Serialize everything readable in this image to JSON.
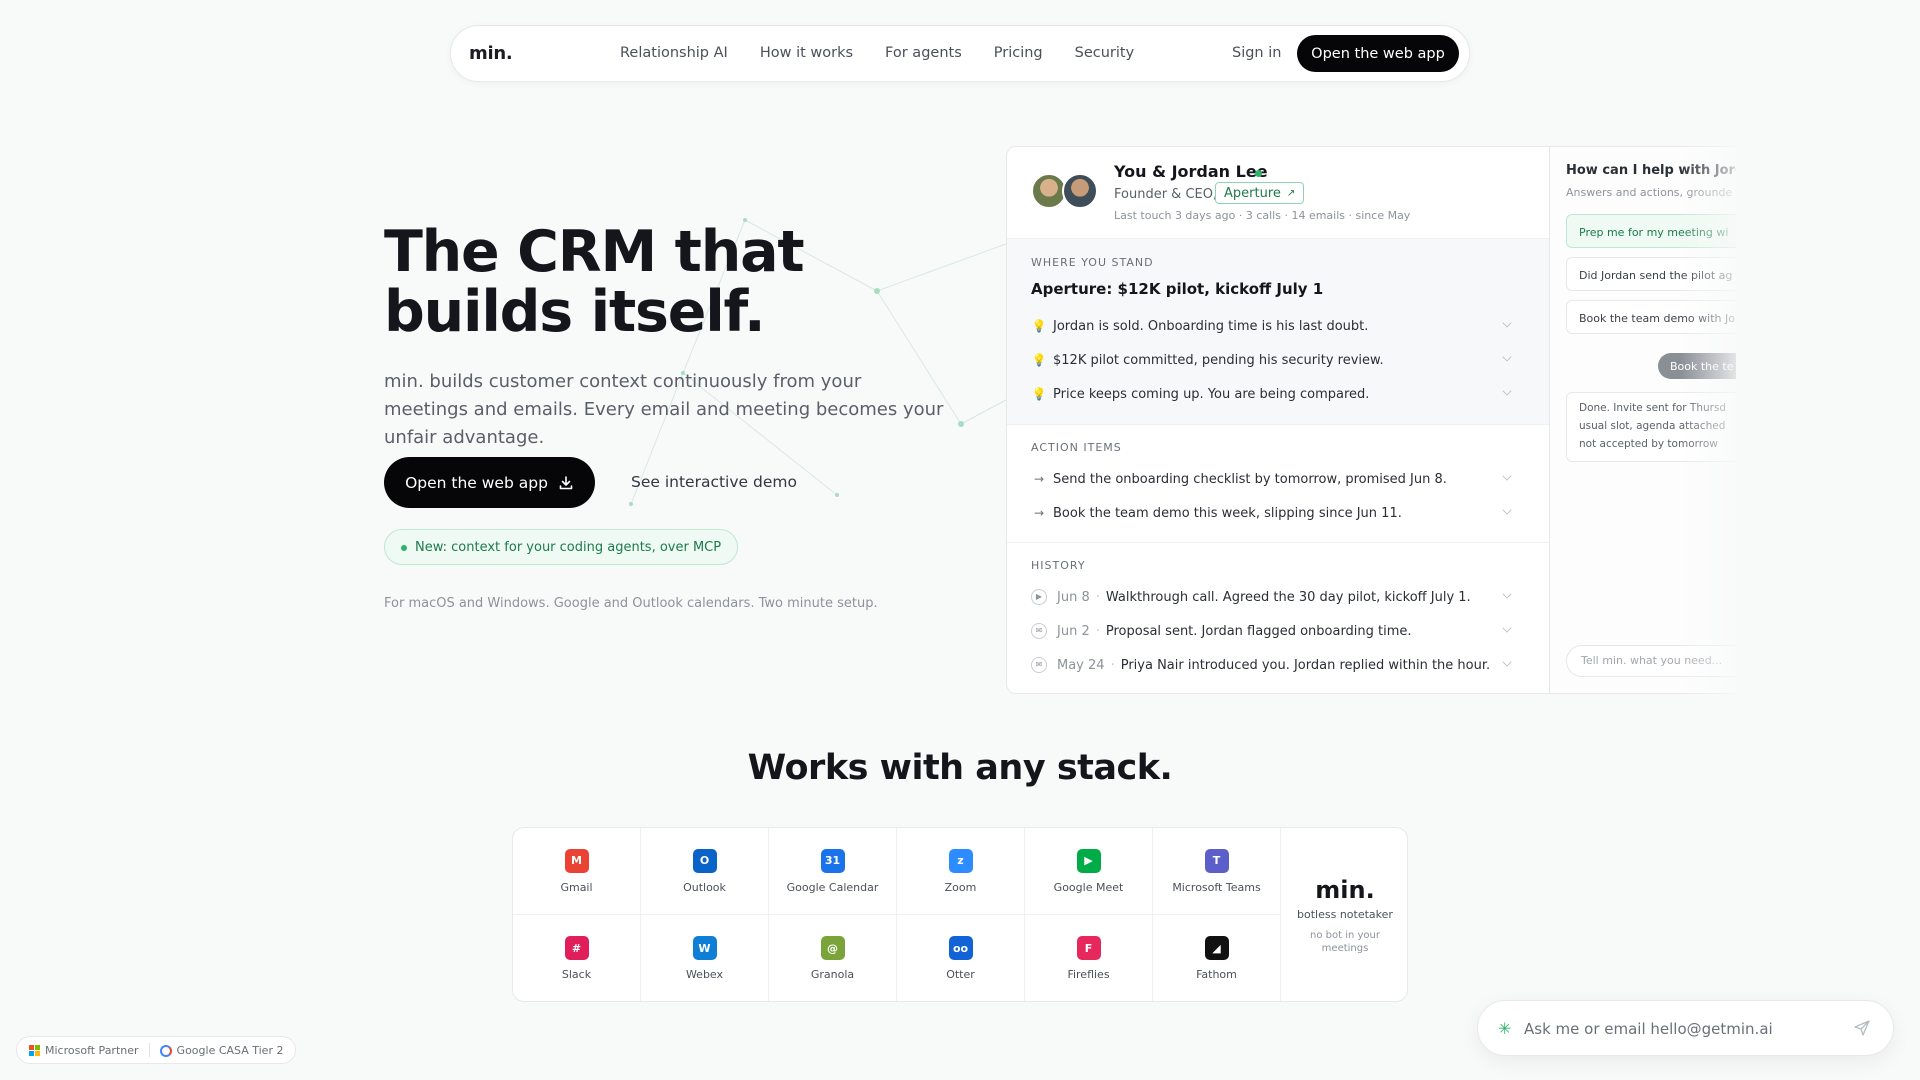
{
  "nav": {
    "logo": "min.",
    "links": [
      "Relationship AI",
      "How it works",
      "For agents",
      "Pricing",
      "Security"
    ],
    "signin": "Sign in",
    "cta": "Open the web app"
  },
  "hero": {
    "title": "The CRM that builds itself.",
    "subtitle": "min. builds customer context continuously from your meetings and emails. Every email and meeting becomes your unfair advantage.",
    "primary_button": "Open the web app",
    "demo_link": "See interactive demo",
    "mcp_pill": "New: context for your coding agents, over MCP",
    "platform_note": "For macOS and Windows. Google and Outlook calendars. Two minute setup."
  },
  "card": {
    "name": "You & Jordan Lee",
    "role": "Founder & CEO,",
    "company": "Aperture",
    "meta": "Last touch 3 days ago · 3 calls · 14 emails · since May",
    "where_label": "WHERE YOU STAND",
    "where_headline": "Aperture: $12K pilot, kickoff July 1",
    "where_items": [
      "Jordan is sold. Onboarding time is his last doubt.",
      "$12K pilot committed, pending his security review.",
      "Price keeps coming up. You are being compared."
    ],
    "actions_label": "ACTION ITEMS",
    "actions": [
      "Send the onboarding checklist by tomorrow, promised Jun 8.",
      "Book the team demo this week, slipping since Jun 11."
    ],
    "history_label": "HISTORY",
    "history": [
      {
        "date": "Jun 8",
        "text": "Walkthrough call. Agreed the 30 day pilot, kickoff July 1."
      },
      {
        "date": "Jun 2",
        "text": "Proposal sent. Jordan flagged onboarding time."
      },
      {
        "date": "May 24",
        "text": "Priya Nair introduced you. Jordan replied within the hour."
      }
    ]
  },
  "side": {
    "question": "How can I help with Jorda",
    "sub": "Answers and actions, grounde",
    "suggestions": [
      "Prep me for my meeting wi",
      "Did Jordan send the pilot ag",
      "Book the team demo with Jo"
    ],
    "bubble": "Book the te",
    "reply": "Done. Invite sent for Thursd usual slot, agenda attached not accepted by tomorrow",
    "input_placeholder": "Tell min. what you need..."
  },
  "stack": {
    "title": "Works with any stack.",
    "row1": [
      {
        "name": "Gmail",
        "icon": "gmail-icon",
        "color": "#ea4335",
        "glyph": "M"
      },
      {
        "name": "Outlook",
        "icon": "outlook-icon",
        "color": "#0a64c8",
        "glyph": "O"
      },
      {
        "name": "Google Calendar",
        "icon": "google-calendar-icon",
        "color": "#1a73e8",
        "glyph": "31"
      },
      {
        "name": "Zoom",
        "icon": "zoom-icon",
        "color": "#2d8cff",
        "glyph": "z"
      },
      {
        "name": "Google Meet",
        "icon": "google-meet-icon",
        "color": "#00ac47",
        "glyph": "▶"
      },
      {
        "name": "Microsoft Teams",
        "icon": "teams-icon",
        "color": "#5b5fc7",
        "glyph": "T"
      }
    ],
    "row2": [
      {
        "name": "Slack",
        "icon": "slack-icon",
        "color": "#e01e5a",
        "glyph": "#"
      },
      {
        "name": "Webex",
        "icon": "webex-icon",
        "color": "#0f7fd6",
        "glyph": "W"
      },
      {
        "name": "Granola",
        "icon": "granola-icon",
        "color": "#7aa33a",
        "glyph": "@"
      },
      {
        "name": "Otter",
        "icon": "otter-icon",
        "color": "#1264d6",
        "glyph": "oo"
      },
      {
        "name": "Fireflies",
        "icon": "fireflies-icon",
        "color": "#e6285c",
        "glyph": "F"
      },
      {
        "name": "Fathom",
        "icon": "fathom-icon",
        "color": "#111111",
        "glyph": "◢"
      }
    ],
    "min_logo": "min.",
    "min_title": "botless notetaker",
    "min_sub": "no bot in your meetings"
  },
  "badges": {
    "microsoft": "Microsoft Partner",
    "google": "Google CASA Tier 2"
  },
  "ask": {
    "placeholder": "Ask me or email hello@getmin.ai"
  },
  "colors": {
    "accent_green": "#2fb26e",
    "primary_black": "#060608"
  }
}
